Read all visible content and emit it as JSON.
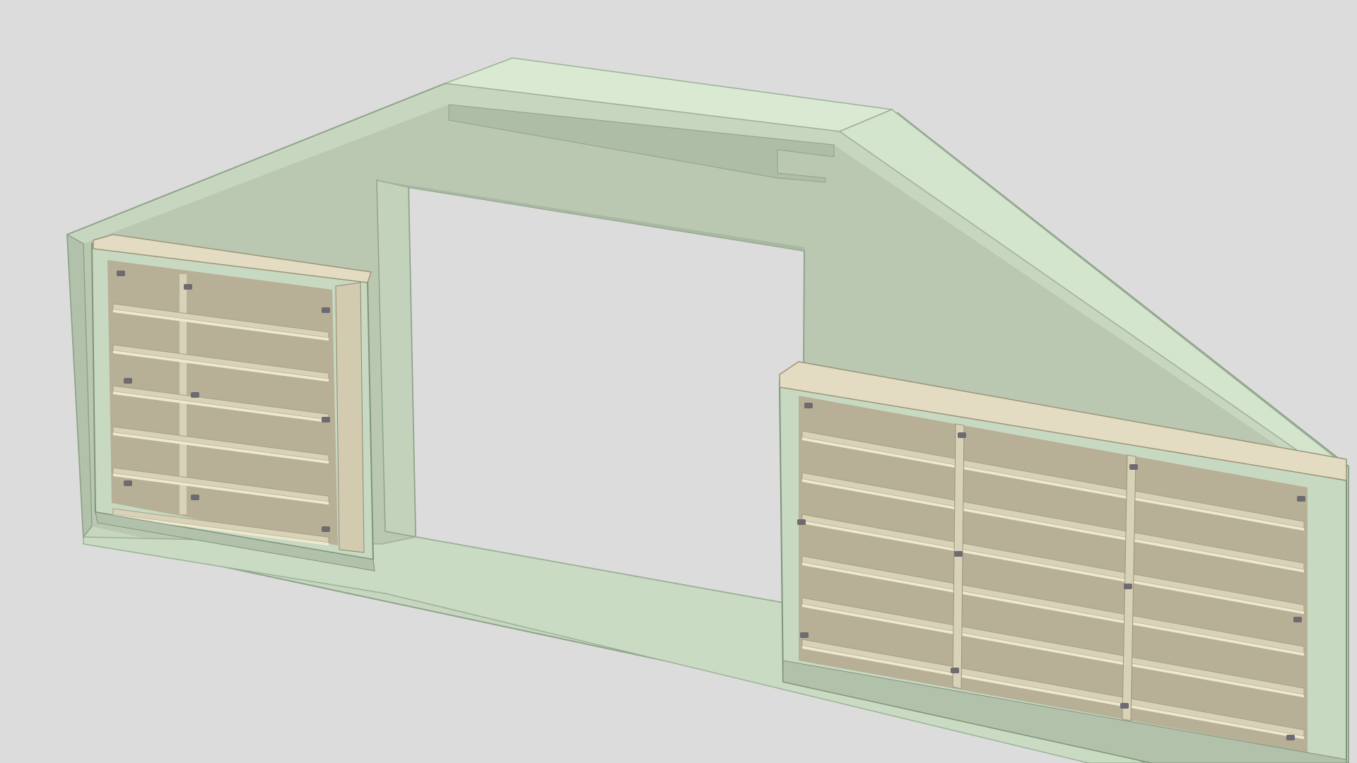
{
  "viewport": {
    "background": "#dcdcdc"
  },
  "colors": {
    "wall_face": "#bccab3",
    "wall_top": "#d7e7d0",
    "wall_outer": "#c6d6bf",
    "wall_edge": "#8ea38a",
    "cabinet_frame": "#c8d9c2",
    "cabinet_interior": "#cfc7ac",
    "cabinet_back": "#b8b096",
    "shelf": "#d8d2b8",
    "shelf_edge": "#eee8cf",
    "hinge": "#6d6a70"
  },
  "model": {
    "subject": "attic-wall-with-built-in-bookcases",
    "left_cabinet": {
      "columns": 2,
      "shelf_rows": 6
    },
    "right_cabinet": {
      "columns": 3,
      "shelf_rows": 6
    }
  }
}
